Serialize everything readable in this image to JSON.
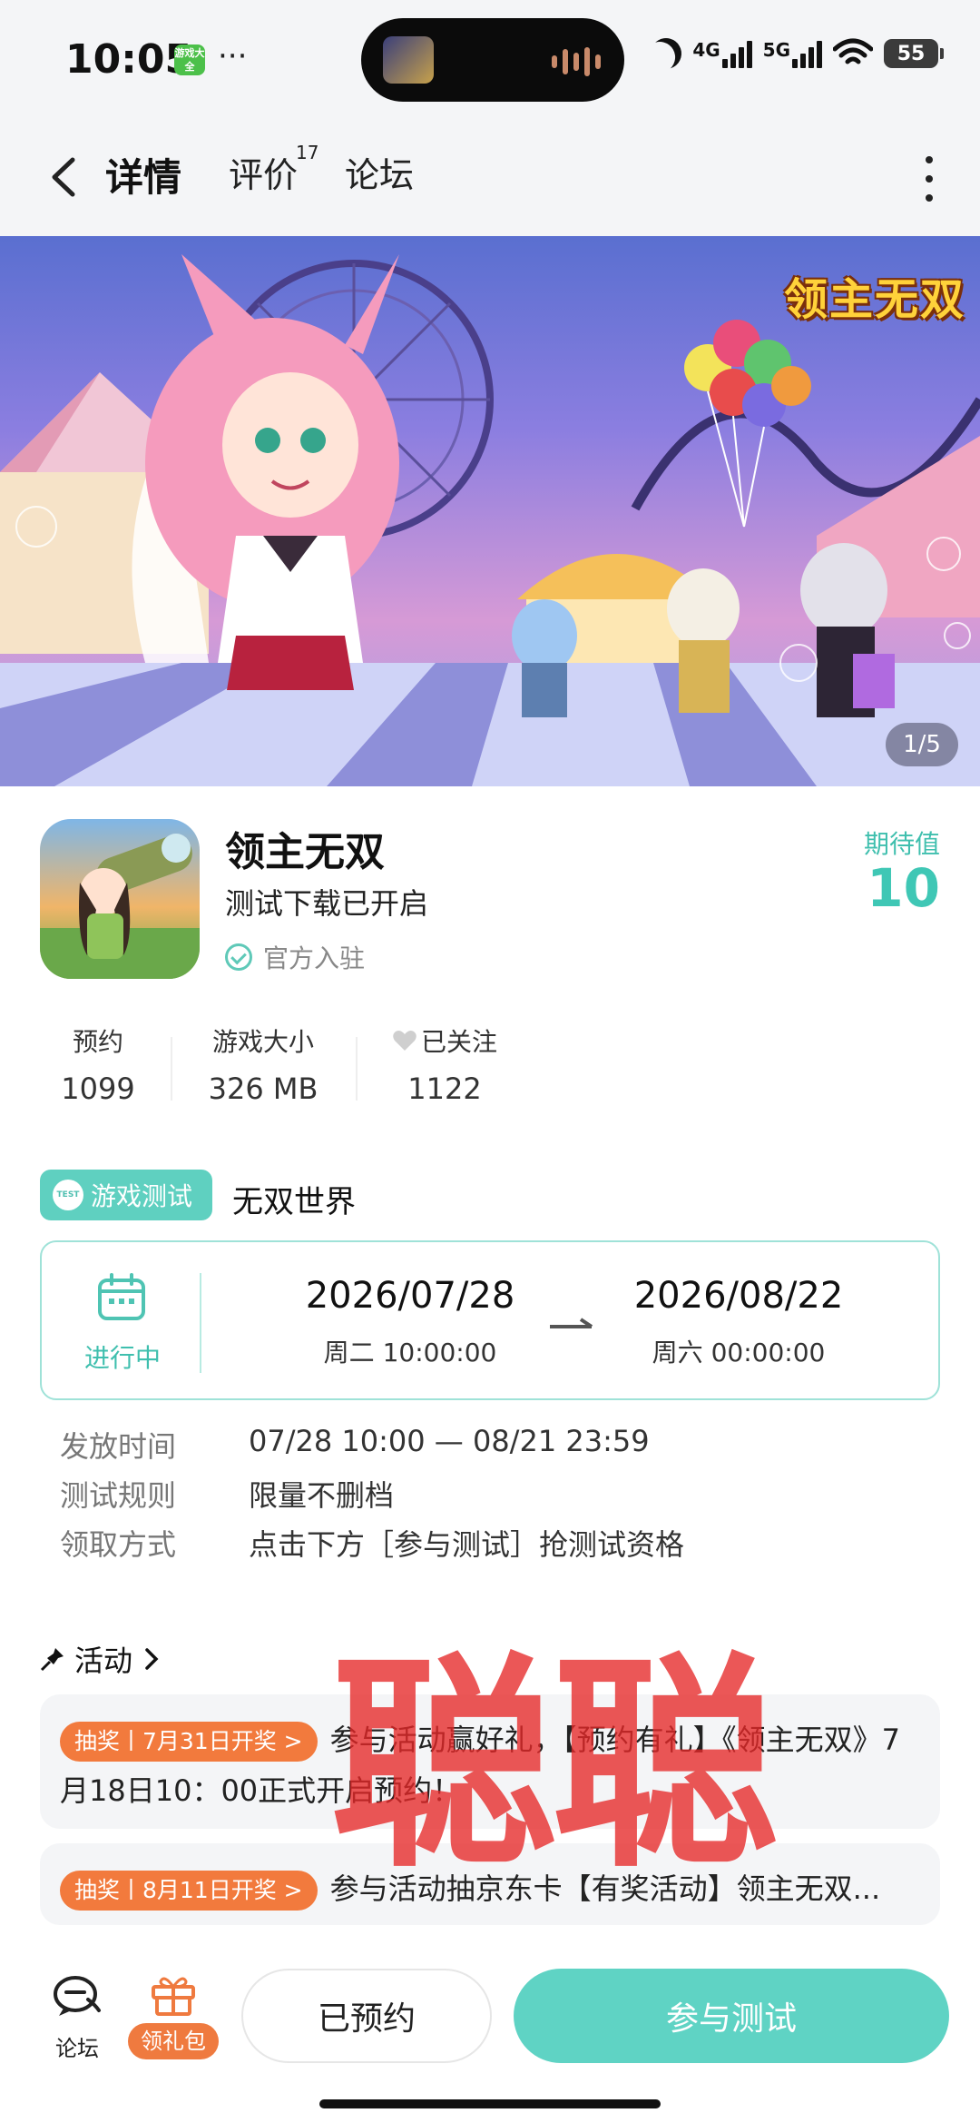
{
  "status_bar": {
    "time": "10:05",
    "app_chip": "游戏大全",
    "network_1": "4G",
    "network_2": "5G",
    "battery": "55",
    "icons": [
      "moon-icon",
      "signal-icon",
      "wifi-icon",
      "battery-icon"
    ]
  },
  "nav": {
    "tabs": [
      {
        "label": "详情",
        "active": true
      },
      {
        "label": "评价",
        "badge": "17"
      },
      {
        "label": "论坛"
      }
    ],
    "accent": "#5fd3c4"
  },
  "banner": {
    "logo_text": "领主无双",
    "page_indicator": "1/5"
  },
  "game": {
    "title": "领主无双",
    "subtitle": "测试下载已开启",
    "official_label": "官方入驻",
    "expect_label": "期待值",
    "expect_value": "10"
  },
  "stats": [
    {
      "label": "预约",
      "value": "1099"
    },
    {
      "label": "游戏大小",
      "value": "326 MB"
    },
    {
      "label": "已关注",
      "value": "1122"
    }
  ],
  "test": {
    "badge": "游戏测试",
    "badge_icon_text": "TEST",
    "name": "无双世界",
    "status": "进行中",
    "start_date": "2026/07/28",
    "start_time": "周二  10:00:00",
    "end_date": "2026/08/22",
    "end_time": "周六  00:00:00",
    "rows": [
      {
        "key": "发放时间",
        "value": "07/28 10:00 — 08/21 23:59"
      },
      {
        "key": "测试规则",
        "value": "限量不删档"
      },
      {
        "key": "领取方式",
        "value": "点击下方［参与测试］抢测试资格"
      }
    ]
  },
  "activities": {
    "header": "活动",
    "items": [
      {
        "tag": "抽奖丨7月31日开奖 >",
        "text": "参与活动赢好礼，【预约有礼】《领主无双》7月18日10：00正式开启预约！"
      },
      {
        "tag": "抽奖丨8月11日开奖 >",
        "text": "参与活动抽京东卡【有奖活动】领主无双..."
      }
    ]
  },
  "watermark": "聪聪",
  "bottom": {
    "forum_label": "论坛",
    "gift_label": "领礼包",
    "reserved_label": "已预约",
    "join_label": "参与测试",
    "colors": {
      "join": "#5fd3c4",
      "gift": "#ef7a3f"
    }
  }
}
